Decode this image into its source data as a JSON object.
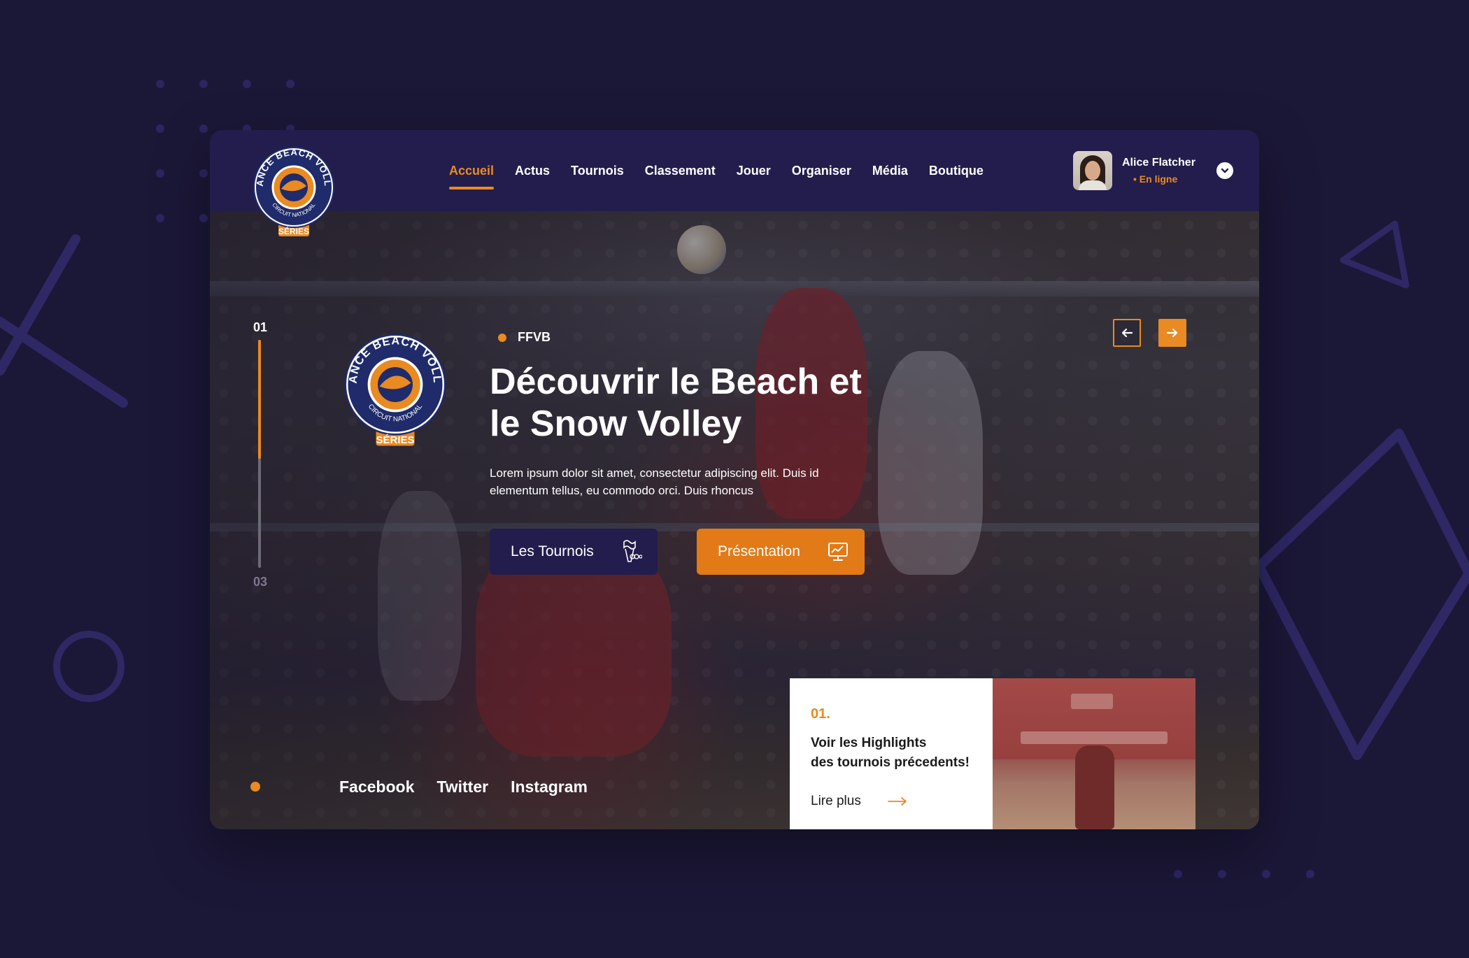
{
  "brand": {
    "logo_text_top": "FRANCE BEACH VOLLEY",
    "logo_text_bottom": "CIRCUIT NATIONAL",
    "logo_badge": "SÉRIES"
  },
  "nav": {
    "items": [
      {
        "label": "Accueil",
        "active": true
      },
      {
        "label": "Actus"
      },
      {
        "label": "Tournois"
      },
      {
        "label": "Classement"
      },
      {
        "label": "Jouer"
      },
      {
        "label": "Organiser"
      },
      {
        "label": "Média"
      },
      {
        "label": "Boutique"
      }
    ]
  },
  "user": {
    "name": "Alice Flatcher",
    "status": "• En ligne"
  },
  "slider": {
    "current": "01",
    "total": "03",
    "progress": 0.52
  },
  "hero": {
    "tag": "FFVB",
    "title_line1": "Découvrir le Beach et",
    "title_line2": "le Snow Volley",
    "description": "Lorem ipsum dolor sit amet, consectetur adipiscing elit. Duis id elementum tellus, eu commodo orci. Duis rhoncus",
    "btn_tournois": "Les Tournois",
    "btn_presentation": "Présentation"
  },
  "social": {
    "facebook": "Facebook",
    "twitter": "Twitter",
    "instagram": "Instagram"
  },
  "highlight": {
    "number": "01.",
    "text_line1": "Voir les Highlights",
    "text_line2": "des tournois précedents!",
    "more": "Lire plus"
  },
  "colors": {
    "background": "#1b1737",
    "navy": "#231d4d",
    "accent": "#e98a22"
  }
}
